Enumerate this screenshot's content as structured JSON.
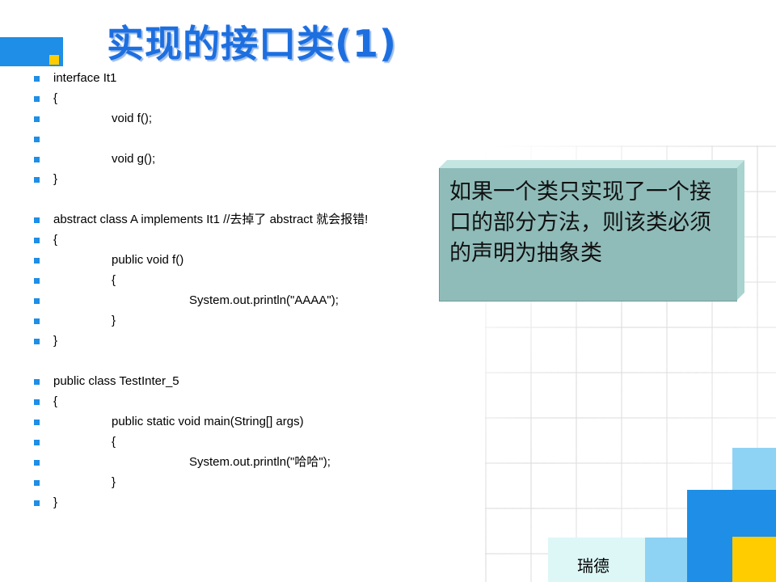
{
  "slide": {
    "title": "实现的接口类(1)",
    "code_lines": [
      {
        "text": "interface It1"
      },
      {
        "text": "{"
      },
      {
        "text": "void f();"
      },
      {
        "text": ""
      },
      {
        "text": "void g();"
      },
      {
        "text": "}"
      },
      {
        "text": "abstract class A implements It1  //去掉了 abstract 就会报错!"
      },
      {
        "text": "{"
      },
      {
        "text": "public void f()"
      },
      {
        "text": "{"
      },
      {
        "text": "System.out.println(\"AAAA\");"
      },
      {
        "text": "}"
      },
      {
        "text": "}"
      },
      {
        "text": "public class TestInter_5"
      },
      {
        "text": "{"
      },
      {
        "text": "public static void main(String[] args)"
      },
      {
        "text": "{"
      },
      {
        "text": "System.out.println(\"哈哈\");"
      },
      {
        "text": "}"
      },
      {
        "text": "}"
      }
    ],
    "callout_text": "如果一个类只实现了一个接口的部分方法，则该类必须的声明为抽象类",
    "footer": "瑞德"
  },
  "colors": {
    "accent_blue": "#1e8ee6",
    "title_blue": "#1d6fe0",
    "accent_yellow": "#ffcc00",
    "callout_bg": "#8fbcb9"
  }
}
